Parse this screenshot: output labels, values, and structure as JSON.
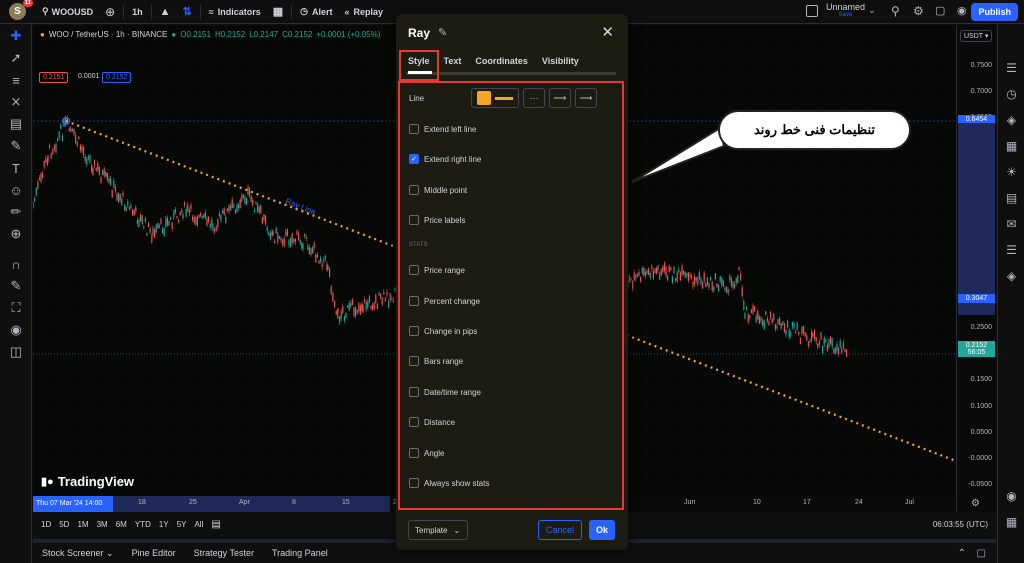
{
  "topbar": {
    "avatar": "S",
    "notifications": "11",
    "symbol": "WOOUSD",
    "interval": "1h",
    "indicators": "Indicators",
    "alert": "Alert",
    "replay": "Replay",
    "layout_name": "Unnamed",
    "layout_status": "Save",
    "publish": "Publish"
  },
  "legend": {
    "title": "WOO / TetherUS · 1h · BINANCE",
    "open": "O0.2151",
    "high": "H0.2152",
    "low": "L0.2147",
    "close": "C0.2152",
    "change": "+0.0001 (+0.05%)",
    "sell": "0.2151",
    "spread": "0.0001",
    "buy": "0.2152"
  },
  "price_scale": {
    "currency": "USDT",
    "ticks": [
      "0.7500",
      "0.7000",
      "0.6500",
      "0.6000",
      "0.5500",
      "0.5000",
      "0.4500",
      "0.4000",
      "0.3500",
      "0.3000",
      "0.2500",
      "0.2000",
      "0.1500",
      "0.1000",
      "0.0500",
      "-0.0000",
      "-0.0500"
    ],
    "label_top": "0.6454",
    "label_mid": "0.3047",
    "label_last": "0.2152",
    "countdown": "56:05"
  },
  "time_scale": {
    "cursor": "Thu 07 Mar '24   14:00",
    "ticks": [
      "18",
      "25",
      "Apr",
      "8",
      "15",
      "2",
      "Jun",
      "10",
      "17",
      "24",
      "Jul"
    ]
  },
  "drawing_label": "Ray Line",
  "ranges": [
    "1D",
    "5D",
    "1M",
    "3M",
    "6M",
    "YTD",
    "1Y",
    "5Y",
    "All"
  ],
  "clock": "06:03:55 (UTC)",
  "panels": [
    "Stock Screener",
    "Pine Editor",
    "Strategy Tester",
    "Trading Panel"
  ],
  "brand": "TradingView",
  "dialog": {
    "title": "Ray",
    "tabs": [
      "Style",
      "Text",
      "Coordinates",
      "Visibility"
    ],
    "line_label": "Line",
    "options": [
      {
        "label": "Extend left line",
        "checked": false
      },
      {
        "label": "Extend right line",
        "checked": true
      },
      {
        "label": "Middle point",
        "checked": false
      },
      {
        "label": "Price labels",
        "checked": false
      }
    ],
    "stats_header": "STATS",
    "stats": [
      "Price range",
      "Percent change",
      "Change in pips",
      "Bars range",
      "Date/time range",
      "Distance",
      "Angle",
      "Always show stats"
    ],
    "template": "Template",
    "cancel": "Cancel",
    "ok": "Ok"
  },
  "annotation": "تنظیمات فنی خط روند",
  "colors": {
    "accent": "#2962ff",
    "ray": "#f5a623",
    "highlight": "#e53935",
    "down": "#ef5350",
    "up": "#26a69a"
  }
}
